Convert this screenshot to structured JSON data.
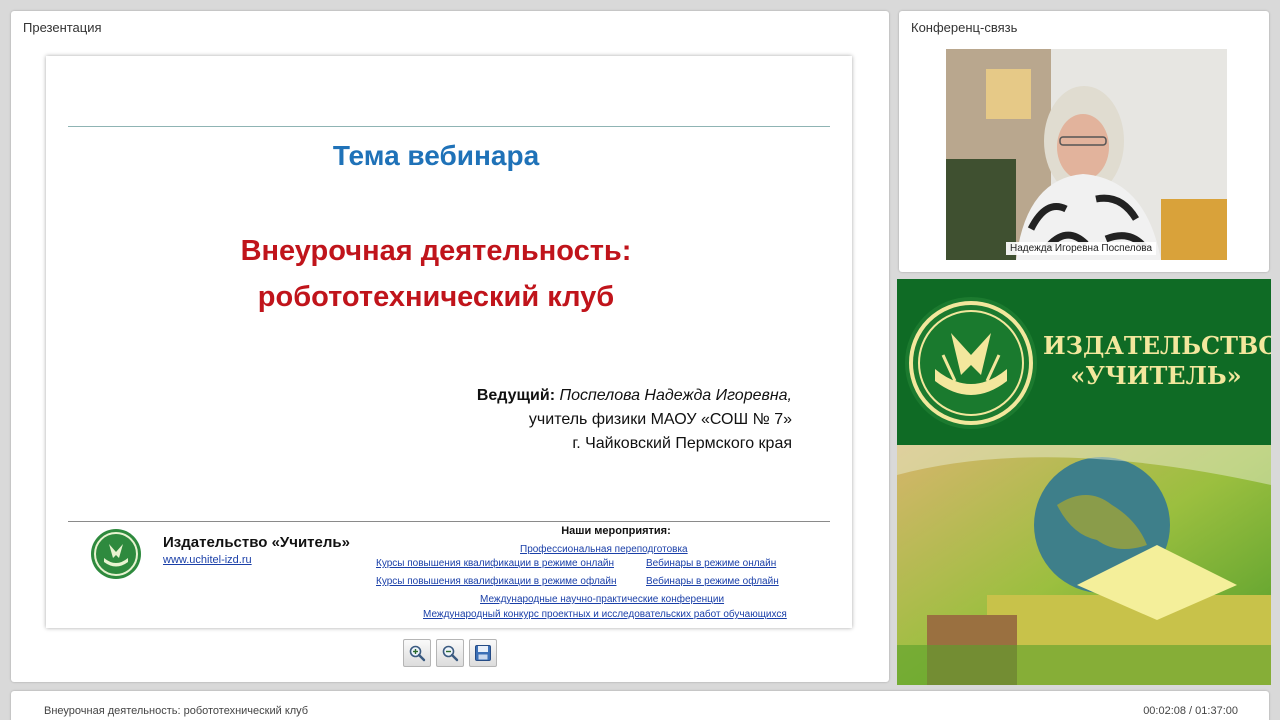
{
  "presentation": {
    "panel_title": "Презентация",
    "slide": {
      "topic": "Тема вебинара",
      "title_line1": "Внеурочная деятельность:",
      "title_line2": "робототехнический клуб",
      "host_label": "Ведущий:",
      "host_name": "Поспелова Надежда Игоревна,",
      "host_line2": "учитель физики МАОУ «СОШ № 7»",
      "host_line3": "г. Чайковский Пермского края",
      "publisher_name": "Издательство «Учитель»",
      "publisher_url": "www.uchitel-izd.ru",
      "events_title": "Наши мероприятия:",
      "events": [
        "Профессиональная переподготовка",
        "Курсы повышения квалификации в режиме онлайн",
        "Вебинары в режиме онлайн",
        "Курсы повышения квалификации в режиме офлайн",
        "Вебинары в режиме офлайн",
        "Международные научно-практические конференции",
        "Международный конкурс проектных и исследовательских работ обучающихся"
      ]
    },
    "toolbar_icons": [
      "zoom-in-icon",
      "zoom-out-icon",
      "save-icon"
    ]
  },
  "conference": {
    "panel_title": "Конференц-связь",
    "participant_name": "Надежда Игоревна Поспелова"
  },
  "brand": {
    "line1": "ИЗДАТЕЛЬСТВО",
    "line2": "«УЧИТЕЛЬ»"
  },
  "status": {
    "title": "Внеурочная деятельность: робототехнический клуб",
    "time": "00:02:08 / 01:37:00"
  },
  "colors": {
    "topic": "#1f72b8",
    "title": "#c0141b",
    "brand_green": "#0f6b25",
    "brand_text": "#f3e79d"
  }
}
